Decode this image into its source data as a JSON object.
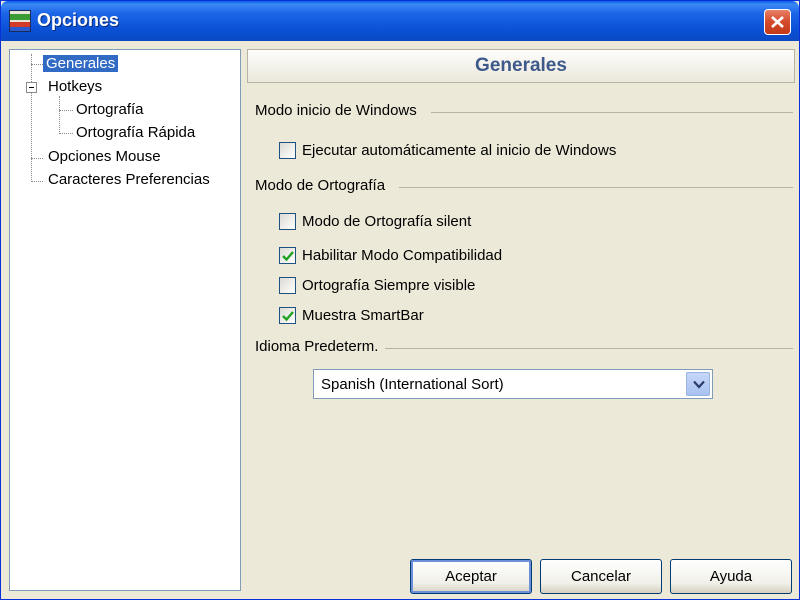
{
  "window": {
    "title": "Opciones"
  },
  "tree": {
    "items": [
      {
        "label": "Generales",
        "selected": true
      },
      {
        "label": "Hotkeys",
        "expanded": true
      },
      {
        "label": "Ortografía"
      },
      {
        "label": "Ortografía Rápida"
      },
      {
        "label": "Opciones Mouse"
      },
      {
        "label": "Caracteres Preferencias"
      }
    ]
  },
  "panel": {
    "header": "Generales",
    "group_windows": {
      "label": "Modo inicio de Windows",
      "checkboxes": [
        {
          "label": "Ejecutar automáticamente al inicio de Windows",
          "checked": false
        }
      ]
    },
    "group_spelling": {
      "label": "Modo de Ortografía",
      "checkboxes": [
        {
          "label": "Modo de Ortografía silent",
          "checked": false
        },
        {
          "label": "Habilitar Modo Compatibilidad",
          "checked": true
        },
        {
          "label": "Ortografía Siempre visible",
          "checked": false
        },
        {
          "label": "Muestra SmartBar",
          "checked": true
        }
      ]
    },
    "group_language": {
      "label": "Idioma Predeterm.",
      "selected": "Spanish (International Sort)"
    }
  },
  "buttons": {
    "ok": "Aceptar",
    "cancel": "Cancelar",
    "help": "Ayuda"
  },
  "colors": {
    "titlebar": "#0a5ae6",
    "selection": "#316ac5",
    "header_text": "#3d5a8a",
    "check": "#21a121"
  }
}
